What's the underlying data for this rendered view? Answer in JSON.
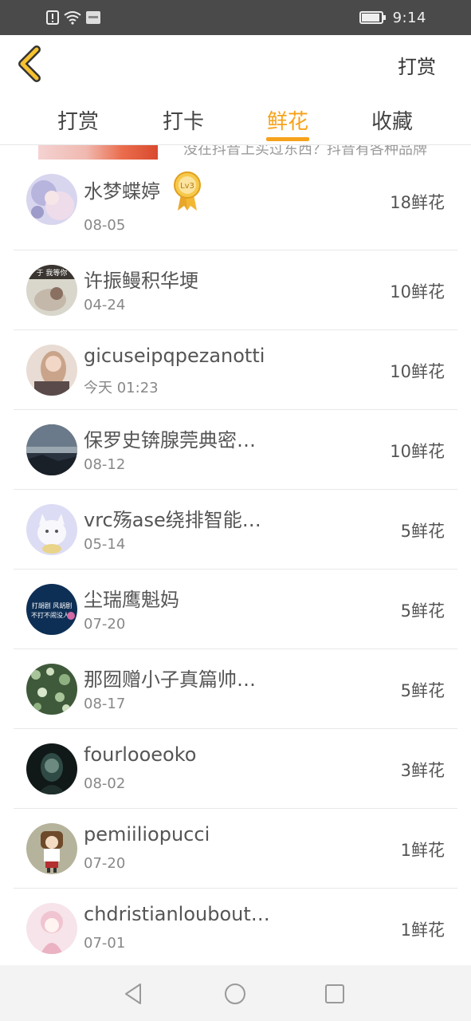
{
  "status_bar": {
    "time": "9:14",
    "icons": [
      "alert-icon",
      "wifi-icon",
      "sms-icon",
      "battery-icon"
    ]
  },
  "header": {
    "back_icon": "chevron-left-icon",
    "action_label": "打赏"
  },
  "tabs": [
    {
      "label": "打赏",
      "active": false
    },
    {
      "label": "打卡",
      "active": false
    },
    {
      "label": "鲜花",
      "active": true
    },
    {
      "label": "收藏",
      "active": false
    }
  ],
  "ad_peek": {
    "text": "没在抖音上买过东西？抖音有各种品牌"
  },
  "list": [
    {
      "name": "水梦蝶婷",
      "date": "08-05",
      "amount": "18鲜花",
      "badge": "Lv3"
    },
    {
      "name": "许振鳗积华埂",
      "date": "04-24",
      "amount": "10鲜花"
    },
    {
      "name": "gicuseipqpezanotti",
      "date": "今天 01:23",
      "amount": "10鲜花"
    },
    {
      "name": "保罗史锛腺莞典密…",
      "date": "08-12",
      "amount": "10鲜花"
    },
    {
      "name": "vrc殇ase绕排智能…",
      "date": "05-14",
      "amount": "5鲜花"
    },
    {
      "name": "尘瑞鹰魁妈",
      "date": "07-20",
      "amount": "5鲜花"
    },
    {
      "name": "那囫赠小子真篇帅…",
      "date": "08-17",
      "amount": "5鲜花"
    },
    {
      "name": "fourlooeoko",
      "date": "08-02",
      "amount": "3鲜花"
    },
    {
      "name": "pemiiliopucci",
      "date": "07-20",
      "amount": "1鲜花"
    },
    {
      "name": "chdristianloubout…",
      "date": "07-01",
      "amount": "1鲜花"
    }
  ],
  "avatar_texts": {
    "row2": "于 我等你",
    "row6_line1": "打胡剧 风胡剧",
    "row6_line2": "不打不闹没人"
  },
  "colors": {
    "accent": "#f7a21b",
    "status_bar": "#4a4a4a",
    "nav_bar": "#f3f3f3"
  },
  "nav_bar": {
    "icons": [
      "back-triangle-icon",
      "home-circle-icon",
      "recents-square-icon"
    ]
  }
}
